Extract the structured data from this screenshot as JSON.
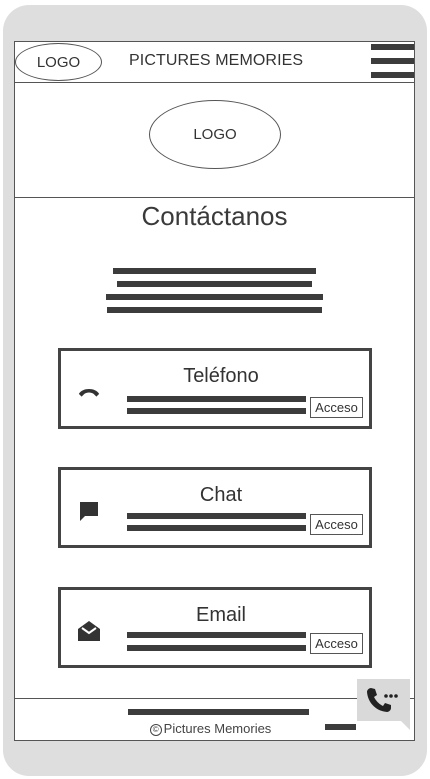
{
  "header": {
    "logo_label": "LOGO",
    "brand": "PICTURES MEMORIES",
    "menu_icon": "hamburger-icon"
  },
  "hero": {
    "logo_label": "LOGO"
  },
  "page": {
    "title": "Contáctanos"
  },
  "contacts": [
    {
      "title": "Teléfono",
      "icon": "phone-icon",
      "button_label": "Acceso"
    },
    {
      "title": "Chat",
      "icon": "chat-icon",
      "button_label": "Acceso"
    },
    {
      "title": "Email",
      "icon": "email-icon",
      "button_label": "Acceso"
    }
  ],
  "footer": {
    "copyright": "Pictures Memories",
    "copyright_symbol": "©"
  },
  "fab": {
    "icon": "phone-chat-icon"
  },
  "colors": {
    "frame": "#dedede",
    "ink": "#3c3c3c",
    "fab": "#d9d9d9"
  }
}
